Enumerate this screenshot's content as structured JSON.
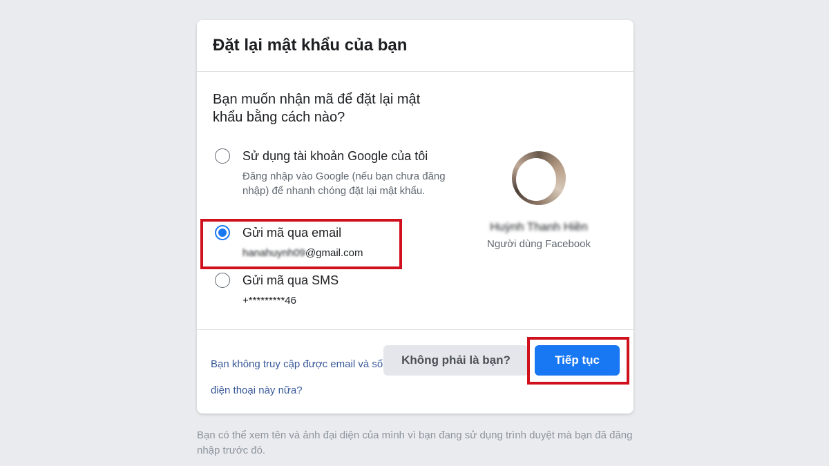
{
  "dialog": {
    "title": "Đặt lại mật khẩu của bạn",
    "question": "Bạn muốn nhận mã để đặt lại mật khẩu bằng cách nào?"
  },
  "options": [
    {
      "label": "Sử dụng tài khoản Google của tôi",
      "description": "Đăng nhập vào Google (nếu bạn chưa đăng nhập) để nhanh chóng đặt lại mật khẩu.",
      "selected": false
    },
    {
      "label": "Gửi mã qua email",
      "value_masked": "hanahuynh09",
      "value_domain": "@gmail.com",
      "selected": true
    },
    {
      "label": "Gửi mã qua SMS",
      "value": "+*********46",
      "selected": false
    }
  ],
  "profile": {
    "name": "Huỳnh Thanh Hiền",
    "subtitle": "Người dùng Facebook"
  },
  "footer": {
    "help_link": "Bạn không truy cập được email và số điện thoại này nữa?",
    "not_you_button": "Không phải là bạn?",
    "continue_button": "Tiếp tục"
  },
  "page_note": "Bạn có thể xem tên và ảnh đại diện của mình vì bạn đang sử dụng trình duyệt mà bạn đã đăng nhập trước đó.",
  "colors": {
    "primary": "#1877f2",
    "highlight": "#d0101c",
    "link": "#385898"
  }
}
